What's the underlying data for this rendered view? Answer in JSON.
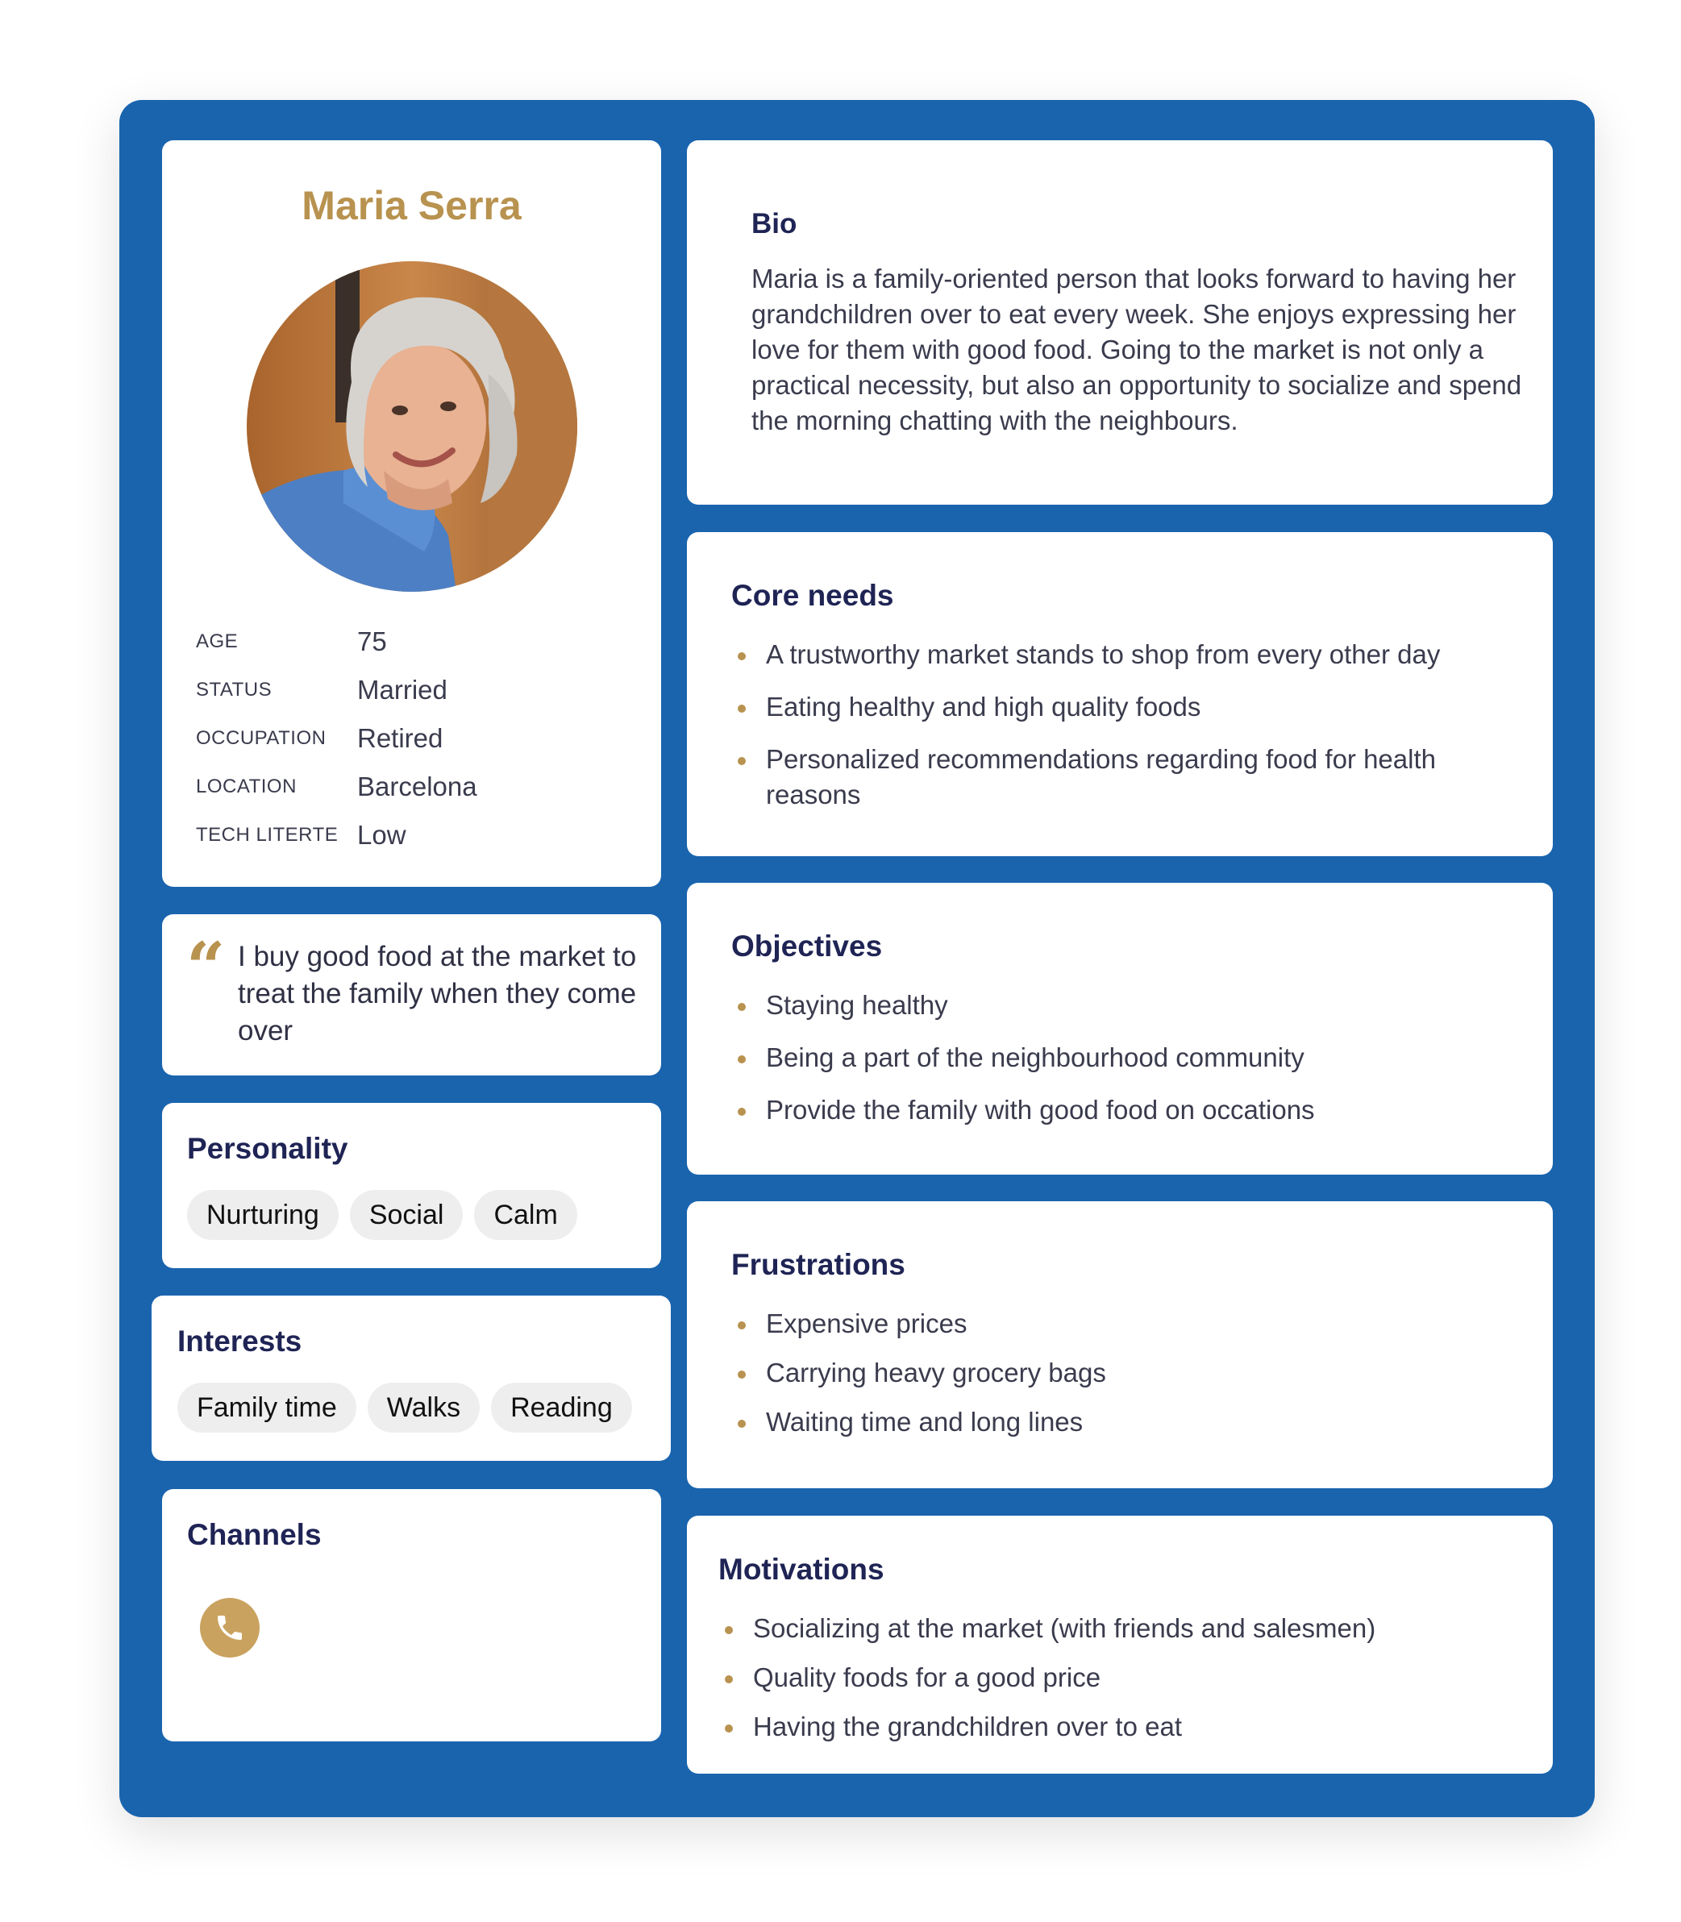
{
  "profile": {
    "name": "Maria Serra",
    "facts": [
      {
        "label": "AGE",
        "value": "75"
      },
      {
        "label": "STATUS",
        "value": "Married"
      },
      {
        "label": "OCCUPATION",
        "value": "Retired"
      },
      {
        "label": "LOCATION",
        "value": "Barcelona"
      },
      {
        "label": "TECH  LITERTE",
        "value": "Low"
      }
    ]
  },
  "quote": {
    "text": "I buy good food at the market to treat the family when they come over"
  },
  "personality": {
    "title": "Personality",
    "tags": [
      "Nurturing",
      "Social",
      "Calm"
    ]
  },
  "interests": {
    "title": "Interests",
    "tags": [
      "Family time",
      "Walks",
      "Reading"
    ]
  },
  "channels": {
    "title": "Channels",
    "icons": [
      "phone-icon"
    ]
  },
  "bio": {
    "title": "Bio",
    "text": "Maria is a family-oriented person that looks forward to having her grandchildren over to eat every week. She enjoys expressing her love for them with good food. Going to the market is not only a practical necessity, but also an opportunity to socialize and spend the morning chatting with the neighbours."
  },
  "core_needs": {
    "title": "Core needs",
    "items": [
      "A trustworthy market stands to shop from every other day",
      "Eating healthy and high quality foods",
      "Personalized recommendations regarding food for health reasons"
    ]
  },
  "objectives": {
    "title": "Objectives",
    "items": [
      "Staying healthy",
      "Being a part of the neighbourhood community",
      "Provide the family with good food on occations"
    ]
  },
  "frustrations": {
    "title": "Frustrations",
    "items": [
      "Expensive prices",
      "Carrying heavy grocery bags",
      "Waiting time and long lines"
    ]
  },
  "motivations": {
    "title": "Motivations",
    "items": [
      "Socializing at the market (with friends and salesmen)",
      "Quality foods for a good price",
      "Having the grandchildren over to eat"
    ]
  },
  "colors": {
    "frame": "#1a64ae",
    "accent": "#b8924f",
    "heading": "#1f2455",
    "chip": "#eeeeee"
  }
}
